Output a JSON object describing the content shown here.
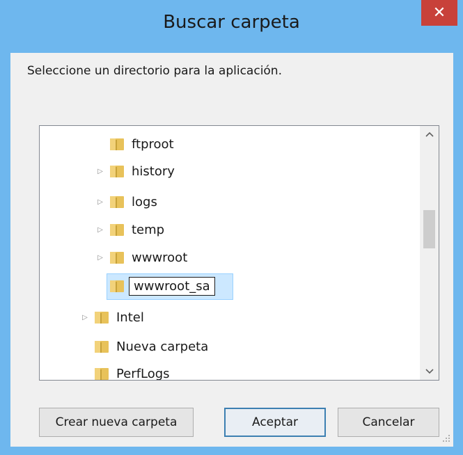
{
  "window": {
    "title": "Buscar carpeta"
  },
  "dialog": {
    "prompt": "Seleccione un directorio para la aplicación."
  },
  "tree": {
    "items": [
      {
        "label": "ftproot",
        "expandable": false
      },
      {
        "label": "history",
        "expandable": true
      },
      {
        "label": "logs",
        "expandable": true
      },
      {
        "label": "temp",
        "expandable": true
      },
      {
        "label": "wwwroot",
        "expandable": true
      },
      {
        "label": "wwwroot_sa",
        "expandable": false,
        "editing": true
      },
      {
        "label": "Intel",
        "expandable": true
      },
      {
        "label": "Nueva carpeta",
        "expandable": false
      },
      {
        "label": "PerfLogs",
        "expandable": false
      }
    ]
  },
  "buttons": {
    "create": "Crear nueva carpeta",
    "accept": "Aceptar",
    "cancel": "Cancelar"
  },
  "icons": {
    "close": "close-icon",
    "folder": "folder-icon",
    "expand": "chevron-right-icon",
    "scroll_up": "chevron-up-icon",
    "scroll_down": "chevron-down-icon"
  },
  "colors": {
    "titlebar": "#6eb7ee",
    "close": "#c8413a",
    "folder": "#e8c25a"
  }
}
